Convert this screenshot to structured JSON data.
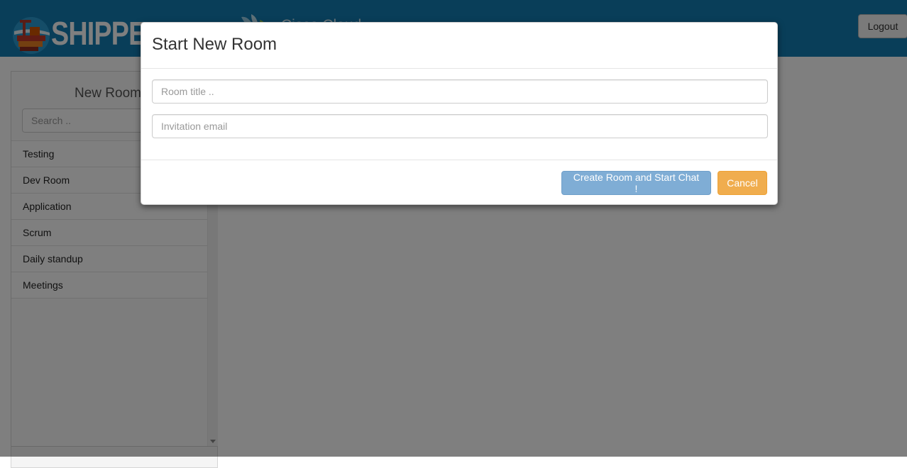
{
  "header": {
    "brand_text": "SHIPPED",
    "partner_text": "Cisco Cloud",
    "logout_label": "Logout"
  },
  "sidebar": {
    "title": "New Room",
    "search_placeholder": "Search ..",
    "rooms": [
      "Testing",
      "Dev Room",
      "Application",
      "Scrum",
      "Daily standup",
      "Meetings"
    ]
  },
  "modal": {
    "title": "Start New Room",
    "room_title_placeholder": "Room title ..",
    "invite_email_placeholder": "Invitation email",
    "create_label": "Create Room and Start Chat !",
    "cancel_label": "Cancel"
  },
  "colors": {
    "header_bg": "#137db2",
    "primary_button": "#7fadd5",
    "warning_button": "#f0ad4e"
  },
  "icons": {
    "brand": "shipped-container-ship-logo",
    "partner": "cisco-leaf-logo"
  }
}
